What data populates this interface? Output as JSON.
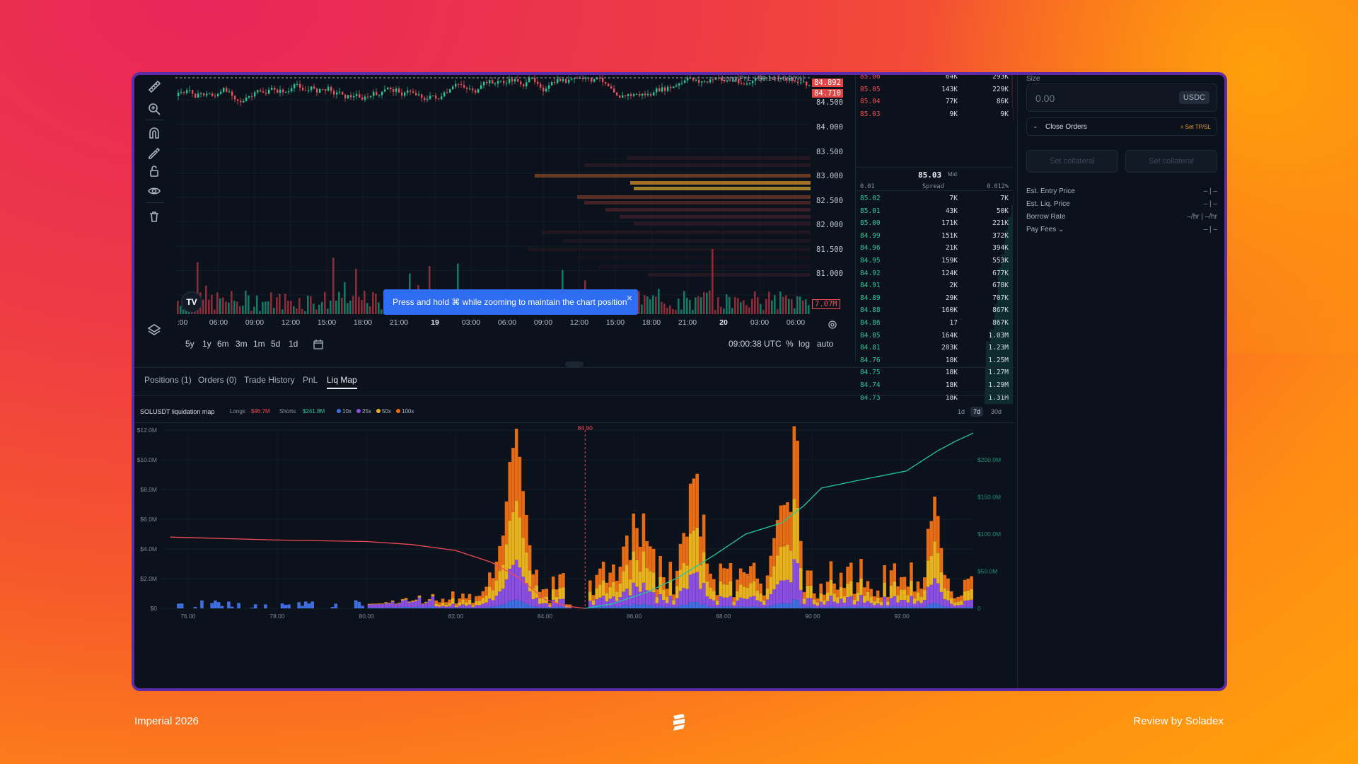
{
  "price_axis": {
    "labels": [
      "84.500",
      "84.000",
      "83.500",
      "83.000",
      "82.500",
      "82.000",
      "81.500",
      "81.000"
    ],
    "last_price_tag": "84.892",
    "second_tag": "84.710",
    "volume_tag": "7.07M",
    "partial_top": "Long PnL: -$0.14 (-0.36%)"
  },
  "time_axis": {
    "labels": [
      ":00",
      "06:00",
      "09:00",
      "12:00",
      "15:00",
      "18:00",
      "21:00",
      "19",
      "03:00",
      "06:00",
      "09:00",
      "12:00",
      "15:00",
      "18:00",
      "21:00",
      "20",
      "03:00",
      "06:00"
    ],
    "bold": [
      "19",
      "20"
    ]
  },
  "range_bar": {
    "ranges": [
      "5y",
      "1y",
      "6m",
      "3m",
      "1m",
      "5d",
      "1d"
    ],
    "clock": "09:00:38 UTC",
    "pct": "%",
    "log": "log",
    "auto": "auto"
  },
  "tv_logo": "TV",
  "toast": {
    "text": "Press and hold ⌘ while zooming to maintain the chart position",
    "close": "×"
  },
  "orderbook": {
    "asks": [
      {
        "price": "85.06",
        "size": "64K",
        "total": "293K",
        "depth": 0.05
      },
      {
        "price": "85.05",
        "size": "143K",
        "total": "229K",
        "depth": 0.04
      },
      {
        "price": "85.04",
        "size": "77K",
        "total": "86K",
        "depth": 0.03
      },
      {
        "price": "85.03",
        "size": "9K",
        "total": "9K",
        "depth": 0.01
      }
    ],
    "mid_price": "85.03",
    "mid_label": "Mid",
    "spread_tick": "0.01",
    "spread_label": "Spread",
    "spread_pct": "0.012%",
    "bids": [
      {
        "price": "85.02",
        "size": "7K",
        "total": "7K",
        "depth": 0.005
      },
      {
        "price": "85.01",
        "size": "43K",
        "total": "50K",
        "depth": 0.04
      },
      {
        "price": "85.00",
        "size": "171K",
        "total": "221K",
        "depth": 0.17
      },
      {
        "price": "84.99",
        "size": "151K",
        "total": "372K",
        "depth": 0.28
      },
      {
        "price": "84.96",
        "size": "21K",
        "total": "394K",
        "depth": 0.3
      },
      {
        "price": "84.95",
        "size": "159K",
        "total": "553K",
        "depth": 0.42
      },
      {
        "price": "84.92",
        "size": "124K",
        "total": "677K",
        "depth": 0.52
      },
      {
        "price": "84.91",
        "size": "2K",
        "total": "678K",
        "depth": 0.52
      },
      {
        "price": "84.89",
        "size": "29K",
        "total": "707K",
        "depth": 0.54
      },
      {
        "price": "84.88",
        "size": "160K",
        "total": "867K",
        "depth": 0.66
      },
      {
        "price": "84.86",
        "size": "17",
        "total": "867K",
        "depth": 0.66
      },
      {
        "price": "84.85",
        "size": "164K",
        "total": "1.03M",
        "depth": 0.79
      },
      {
        "price": "84.81",
        "size": "203K",
        "total": "1.23M",
        "depth": 0.94
      },
      {
        "price": "84.76",
        "size": "18K",
        "total": "1.25M",
        "depth": 0.95
      },
      {
        "price": "84.75",
        "size": "18K",
        "total": "1.27M",
        "depth": 0.97
      },
      {
        "price": "84.74",
        "size": "18K",
        "total": "1.29M",
        "depth": 0.98
      },
      {
        "price": "84.73",
        "size": "18K",
        "total": "1.31M",
        "depth": 1.0
      }
    ]
  },
  "order_panel": {
    "size_label": "Size",
    "size_value": "0.00",
    "size_unit": "USDC",
    "close_orders": "Close Orders",
    "tpsl": "+ Set TP/SL",
    "btn_left": "Set collateral",
    "btn_right": "Set collateral",
    "rows": [
      {
        "label": "Est. Entry Price",
        "value": "– | –"
      },
      {
        "label": "Est. Liq. Price",
        "value": "– | –"
      },
      {
        "label": "Borrow Rate",
        "value": "–/hr | –/hr"
      },
      {
        "label": "Pay Fees ⌄",
        "value": "– | –"
      }
    ]
  },
  "bottom_tabs": [
    "Positions (1)",
    "Orders (0)",
    "Trade History",
    "PnL",
    "Liq Map"
  ],
  "active_tab": "Liq Map",
  "liq_header": {
    "title": "SOLUSDT liquidation map",
    "longs_label": "Longs",
    "longs_value": "$96.7M",
    "shorts_label": "Shorts",
    "shorts_value": "$241.8M",
    "leverages": [
      {
        "label": "10x",
        "color": "#3e6ee0"
      },
      {
        "label": "25x",
        "color": "#8a4fe0"
      },
      {
        "label": "50x",
        "color": "#e8b21f"
      },
      {
        "label": "100x",
        "color": "#e66c16"
      }
    ],
    "periods": [
      "1d",
      "7d",
      "30d"
    ],
    "active_period": "7d"
  },
  "colors": {
    "green": "#1ec99a",
    "red": "#ef4a57",
    "accent_blue": "#2e6cf2",
    "frame": "#5e2aa8"
  },
  "chart_data": {
    "type": "bar",
    "title": "SOLUSDT liquidation map",
    "x_ticks": [
      "76.00",
      "78.00",
      "80.00",
      "82.00",
      "84.00",
      "86.00",
      "88.00",
      "90.00",
      "92.00"
    ],
    "x_range": [
      75.4,
      93.6
    ],
    "y_left_ticks": [
      "$0",
      "$2.0M",
      "$4.0M",
      "$6.0M",
      "$8.0M",
      "$10.0M",
      "$12.0M"
    ],
    "y_left_range": [
      0,
      12
    ],
    "y_right_ticks": [
      "0",
      "$50.0M",
      "$100.0M",
      "$150.0M",
      "$200.0M"
    ],
    "y_right_range": [
      0,
      240
    ],
    "current_price_label": "84.90",
    "current_price": 84.9,
    "long_cumulative": {
      "name": "Longs",
      "x": [
        75.6,
        78,
        80,
        81,
        82,
        82.8,
        83.4,
        84,
        84.5,
        84.9
      ],
      "y": [
        96,
        92,
        90,
        86,
        78,
        62,
        42,
        12,
        3,
        0
      ]
    },
    "short_cumulative": {
      "name": "Shorts",
      "x": [
        84.9,
        85.5,
        86.3,
        87,
        87.8,
        88.5,
        89.3,
        89.8,
        90.2,
        91,
        92.1,
        92.8,
        93.2,
        93.6
      ],
      "y": [
        0,
        6,
        22,
        42,
        72,
        100,
        115,
        138,
        162,
        172,
        185,
        212,
        225,
        236
      ]
    }
  },
  "footer": {
    "left": "Imperial 2026",
    "right": "Review by Soladex"
  }
}
